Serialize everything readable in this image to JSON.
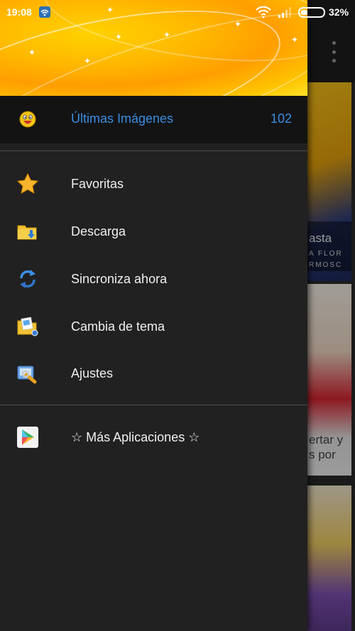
{
  "status_bar": {
    "time": "19:08",
    "battery_percent": "32%"
  },
  "background_content": {
    "card1_caption_a": "asta",
    "card1_caption_b": "A FLOR",
    "card1_caption_c": "RMOSC",
    "card2_caption_a": "ertar y",
    "card2_caption_b": "s por"
  },
  "drawer": {
    "top_item": {
      "label": "Últimas Imágenes",
      "count": "102",
      "icon": "laughing-face-icon",
      "accent_color": "#3b8de0"
    },
    "items": [
      {
        "label": "Favoritas",
        "icon": "star-icon"
      },
      {
        "label": "Descarga",
        "icon": "download-folder-icon"
      },
      {
        "label": "Sincroniza ahora",
        "icon": "sync-icon"
      },
      {
        "label": "Cambia de tema",
        "icon": "theme-folder-icon"
      },
      {
        "label": "Ajustes",
        "icon": "settings-icon"
      }
    ],
    "more_apps": {
      "label": "☆ Más Aplicaciones ☆",
      "icon": "play-store-icon"
    }
  }
}
